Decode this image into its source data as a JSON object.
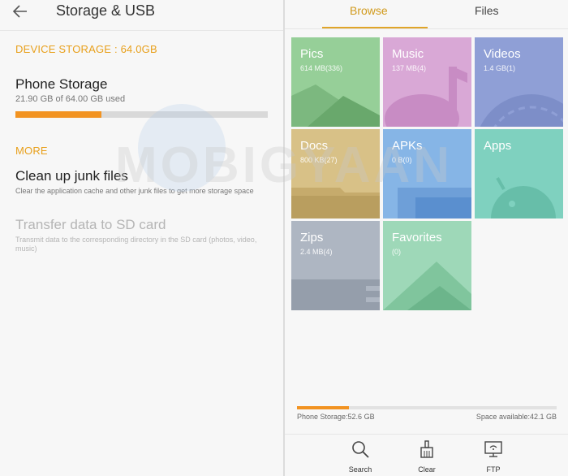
{
  "storage": {
    "title": "Storage & USB",
    "section_device": "DEVICE STORAGE : 64.0GB",
    "phone_storage": {
      "title": "Phone Storage",
      "used": "21.90 GB of 64.00 GB used",
      "used_fraction": 0.342
    },
    "section_more": "MORE",
    "junk": {
      "title": "Clean up junk files",
      "desc": "Clear the application cache and other junk files to get more storage space"
    },
    "transfer": {
      "title": "Transfer data to SD card",
      "desc": "Transmit data to the corresponding directory in the SD card (photos, video, music)"
    }
  },
  "watermark": "MOBIGYAAN",
  "browser": {
    "tabs": [
      "Browse",
      "Files"
    ],
    "categories": [
      {
        "name": "Pics",
        "info": "614 MB(336)",
        "color": "#96cf98"
      },
      {
        "name": "Music",
        "info": "137 MB(4)",
        "color": "#d9a8d6"
      },
      {
        "name": "Videos",
        "info": "1.4 GB(1)",
        "color": "#8f9fd6"
      },
      {
        "name": "Docs",
        "info": "800 KB(27)",
        "color": "#d8c187"
      },
      {
        "name": "APKs",
        "info": "0 B(0)",
        "color": "#86b5e6"
      },
      {
        "name": "Apps",
        "info": "",
        "color": "#7fd1bf"
      },
      {
        "name": "Zips",
        "info": "2.4 MB(4)",
        "color": "#aeb6c2"
      },
      {
        "name": "Favorites",
        "info": "(0)",
        "color": "#9ed8b8"
      }
    ],
    "phone_storage": "Phone Storage:52.6 GB",
    "space_available": "Space available:42.1 GB",
    "used_fraction": 0.2,
    "actions": [
      "Search",
      "Clear",
      "FTP"
    ]
  }
}
